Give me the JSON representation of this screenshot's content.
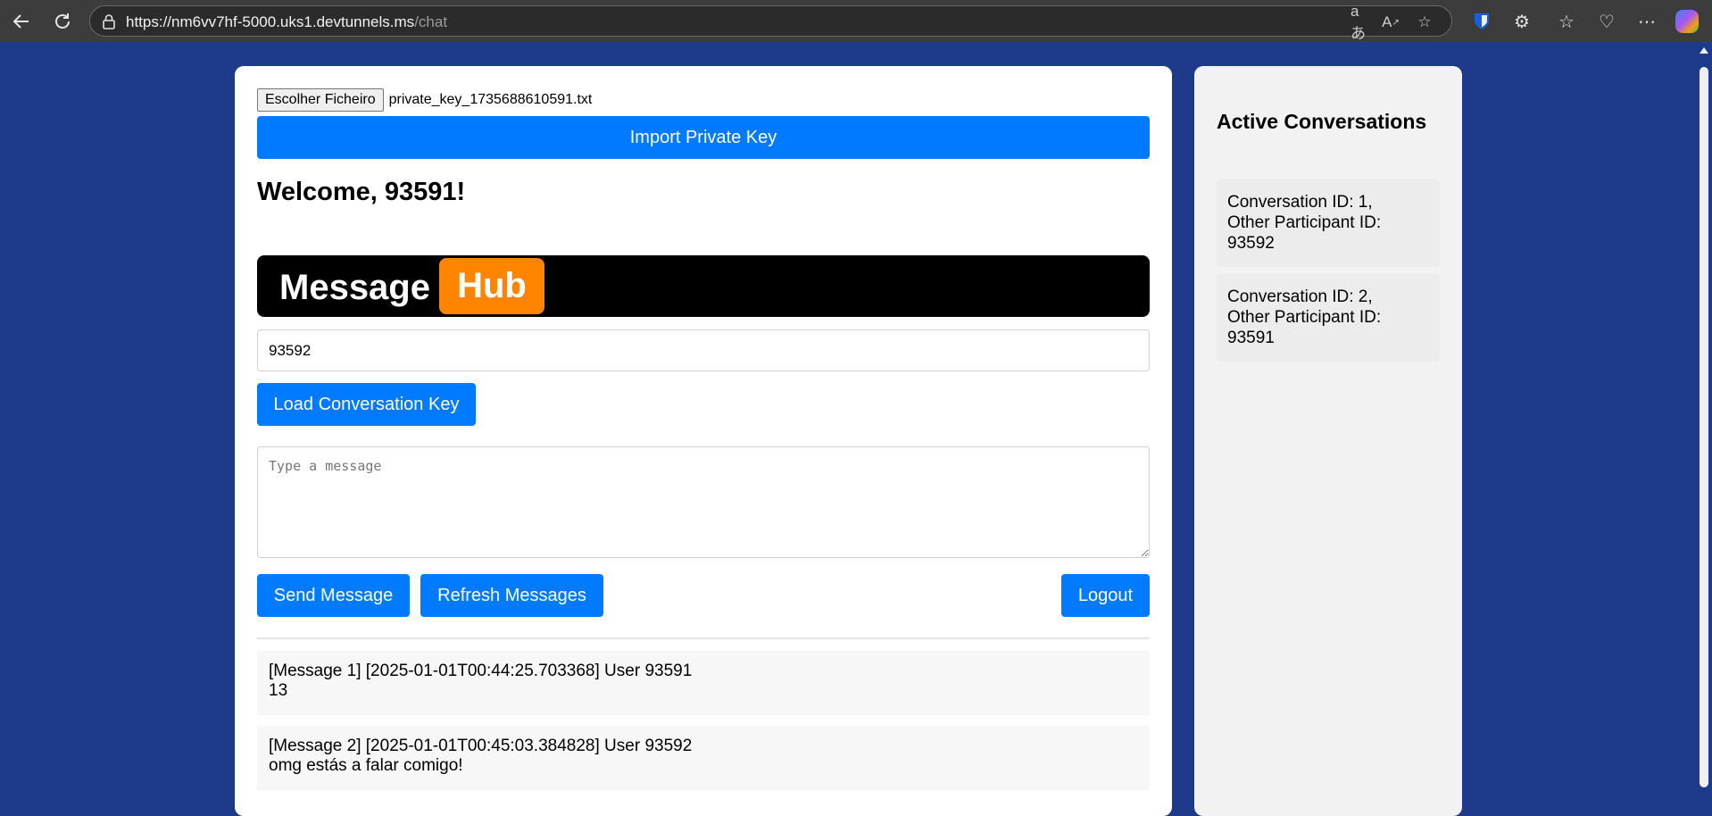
{
  "browser": {
    "url_host": "https://nm6vv7hf-5000.uks1.devtunnels.ms",
    "url_path": "/chat"
  },
  "key_import": {
    "file_button_label": "Escolher Ficheiro",
    "file_name": "private_key_1735688610591.txt",
    "import_button_label": "Import Private Key"
  },
  "welcome_text": "Welcome, 93591!",
  "logo": {
    "text": "Message",
    "badge": "Hub",
    "badge_color": "#ff8400"
  },
  "conversation": {
    "participant_value": "93592",
    "load_key_label": "Load Conversation Key",
    "message_placeholder": "Type a message"
  },
  "actions": {
    "send_label": "Send Message",
    "refresh_label": "Refresh Messages",
    "logout_label": "Logout"
  },
  "messages": [
    {
      "header": "[Message 1] [2025-01-01T00:44:25.703368] User 93591",
      "body": "13"
    },
    {
      "header": "[Message 2] [2025-01-01T00:45:03.384828] User 93592",
      "body": "omg estás a falar comigo!"
    }
  ],
  "sidebar": {
    "title": "Active Conversations",
    "conversations": [
      {
        "line1": "Conversation ID: 1,",
        "line2": "Other Participant ID:",
        "line3": "93592"
      },
      {
        "line1": "Conversation ID: 2,",
        "line2": "Other Participant ID:",
        "line3": "93591"
      }
    ]
  },
  "colors": {
    "primary": "#007bff",
    "page_bg": "#1e3a8a"
  }
}
